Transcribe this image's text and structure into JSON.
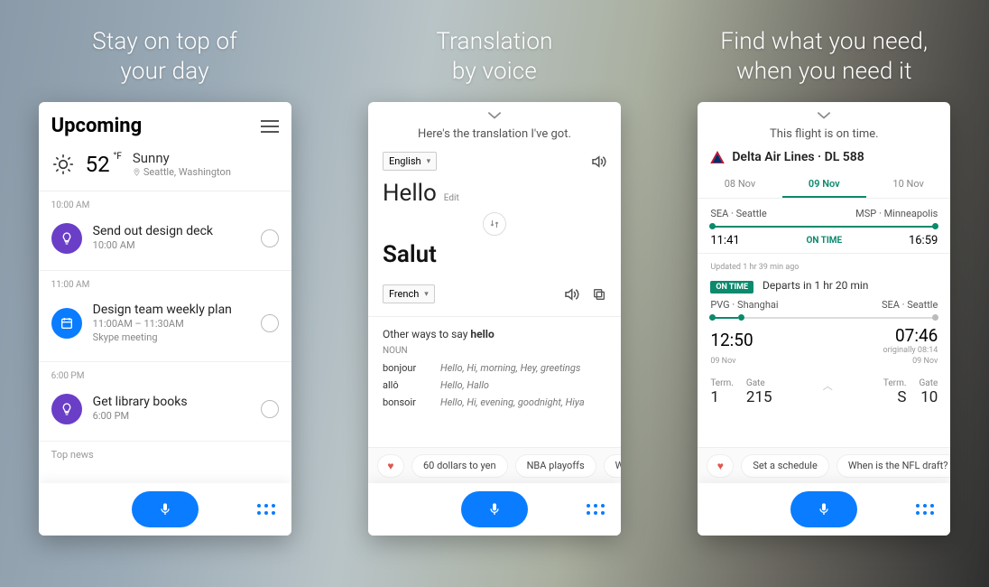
{
  "captions": {
    "c1_l1": "Stay on top of",
    "c1_l2": "your day",
    "c2_l1": "Translation",
    "c2_l2": "by voice",
    "c3_l1": "Find what you need,",
    "c3_l2": "when you need it"
  },
  "card1": {
    "title": "Upcoming",
    "weather": {
      "temp": "52",
      "unit": "°F",
      "condition": "Sunny",
      "location": "Seattle, Washington"
    },
    "sections": [
      {
        "time_label": "10:00 AM",
        "icon": "bulb",
        "icon_bg": "#6a3ec7",
        "title": "Send out design deck",
        "sub1": "10:00 AM",
        "sub2": ""
      },
      {
        "time_label": "11:00 AM",
        "icon": "calendar",
        "icon_bg": "#0a7cff",
        "title": "Design team weekly plan",
        "sub1": "11:00AM – 11:30AM",
        "sub2": "Skype meeting"
      },
      {
        "time_label": "6:00 PM",
        "icon": "bulb",
        "icon_bg": "#6a3ec7",
        "title": "Get library books",
        "sub1": "6:00 PM",
        "sub2": ""
      }
    ],
    "footer": "Top news"
  },
  "card2": {
    "subtitle": "Here's the translation I've got.",
    "src_lang": "English",
    "src_word": "Hello",
    "edit": "Edit",
    "tgt_word": "Salut",
    "tgt_lang": "French",
    "other_header_pre": "Other ways to say ",
    "other_header_word": "hello",
    "noun_label": "NOUN",
    "synonyms": [
      {
        "k": "bonjour",
        "v": "Hello, Hi, morning, Hey, greetings"
      },
      {
        "k": "allô",
        "v": "Hello, Hallo"
      },
      {
        "k": "bonsoir",
        "v": "Hello, Hi, evening, goodnight, Hiya"
      }
    ],
    "chips": [
      "60 dollars to yen",
      "NBA playoffs",
      "What can you"
    ]
  },
  "card3": {
    "status": "This flight is on time.",
    "airline": "Delta Air Lines · DL 588",
    "tabs": [
      "08 Nov",
      "09 Nov",
      "10 Nov"
    ],
    "active_tab": 1,
    "leg1": {
      "from_code": "SEA",
      "from_city": "Seattle",
      "to_code": "MSP",
      "to_city": "Minneapolis",
      "dep": "11:41",
      "arr": "16:59",
      "status": "ON TIME"
    },
    "leg2": {
      "updated": "Updated 1 hr 39 min ago",
      "badge": "ON TIME",
      "departs": "Departs in 1 hr 20 min",
      "from_code": "PVG",
      "from_city": "Shanghai",
      "to_code": "SEA",
      "to_city": "Seattle",
      "dep": "12:50",
      "arr": "07:46",
      "orig": "originally 08:14",
      "dep_date": "09 Nov",
      "arr_date": "09 Nov",
      "term_l_lbl": "Term.",
      "gate_l_lbl": "Gate",
      "term_l": "1",
      "gate_l": "215",
      "term_r_lbl": "Term.",
      "gate_r_lbl": "Gate",
      "term_r": "S",
      "gate_r": "10"
    },
    "chips": [
      "Set a schedule",
      "When is the NFL draft?"
    ]
  }
}
